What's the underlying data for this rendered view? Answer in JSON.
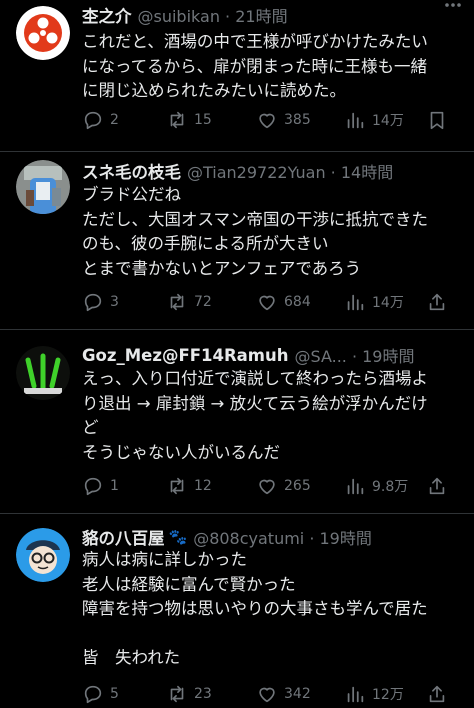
{
  "colors": {
    "background": "#000000",
    "text": "#e7e9ea",
    "muted": "#71767b",
    "divider": "#2f3336"
  },
  "tweets": [
    {
      "name": "杢之介",
      "meta": "@suibikan · 21時間",
      "lines": [
        "これだと、酒場の中で王様が呼びかけたみたい",
        "になってるから、扉が閉まった時に王様も一緒",
        "に閉じ込められたみたいに読めた。"
      ],
      "stats": {
        "replies": "2",
        "retweets": "15",
        "likes": "385",
        "views": "14万"
      },
      "icons": {
        "reply": "reply-icon",
        "retweet": "retweet-icon",
        "like": "heart-icon",
        "views": "views-chart-icon",
        "bookmark": "bookmark-icon"
      }
    },
    {
      "name": "スネ毛の枝毛",
      "meta": "@Tian29722Yuan · 14時間",
      "lines": [
        "ブラド公だね",
        "ただし、大国オスマン帝国の干渉に抵抗できた",
        "のも、彼の手腕による所が大きい",
        "とまで書かないとアンフェアであろう"
      ],
      "stats": {
        "replies": "3",
        "retweets": "72",
        "likes": "684",
        "views": "14万"
      }
    },
    {
      "name": "Goz_Mez@FF14Ramuh",
      "meta": "@SA... · 19時間",
      "lines": [
        "えっ、入り口付近で演説して終わったら酒場よ",
        "り退出 → 扉封鎖 → 放火て云う絵が浮かんだけ",
        "ど",
        "そうじゃない人がいるんだ"
      ],
      "stats": {
        "replies": "1",
        "retweets": "12",
        "likes": "265",
        "views": "9.8万"
      }
    },
    {
      "name": "貉の八百屋",
      "badge": "🐾",
      "meta": "@808cyatumi · 19時間",
      "lines": [
        "病人は病に詳しかった",
        "老人は経験に富んで賢かった",
        "障害を持つ物は思いやりの大事さも学んで居た",
        "",
        "皆　失われた"
      ],
      "stats": {
        "replies": "5",
        "retweets": "23",
        "likes": "342",
        "views": "12万"
      }
    }
  ]
}
